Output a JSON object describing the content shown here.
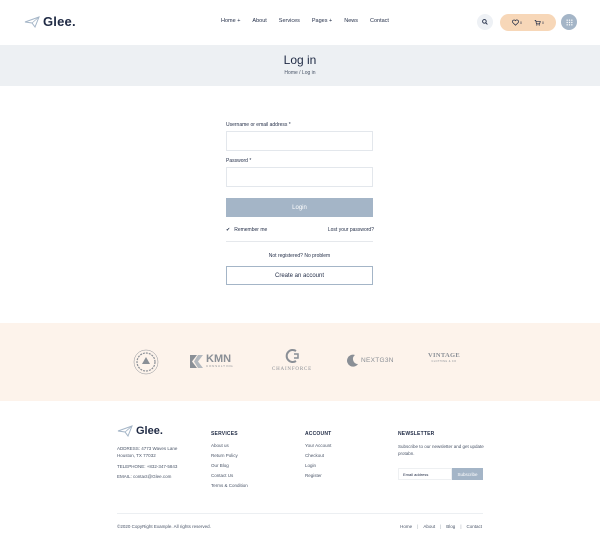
{
  "header": {
    "brand": "Glee.",
    "nav": [
      "Home +",
      "About",
      "Services",
      "Pages +",
      "News",
      "Contact"
    ],
    "pill_count_1": "0",
    "pill_count_2": "0"
  },
  "banner": {
    "title": "Log in",
    "breadcrumb": "Home  /  Log in"
  },
  "form": {
    "username_label": "Username or email address *",
    "password_label": "Password *",
    "login_label": "Login",
    "remember_label": "Remember me",
    "lost_password": "Lost your password?",
    "not_registered": "Not registered? No problem",
    "create_account": "Create an account"
  },
  "partners": [
    {
      "name": "SEA & SUN",
      "sub": "EXCHANGE"
    },
    {
      "name": "KMN",
      "sub": "CONSULTING"
    },
    {
      "name": "CHAINFORCE",
      "sub": ""
    },
    {
      "name": "NEXTG3N",
      "sub": ""
    },
    {
      "name": "VINTAGE",
      "sub": "CLOTHING & CO"
    }
  ],
  "footer": {
    "brand": "Glee.",
    "address_line1": "ADDRESS: 4773 Waves Lane",
    "address_line2": "Houston, TX 77032",
    "telephone": "TELEPHONE: +832-347-5843",
    "email": "EMAIL: contact@Glee.com",
    "services_title": "SERVICES",
    "services": [
      "About us",
      "Return Policy",
      "Our Blog",
      "Contact Us",
      "Terms & Condition"
    ],
    "account_title": "ACCOUNT",
    "account": [
      "Your Account",
      "Checkout",
      "Login",
      "Register"
    ],
    "newsletter_title": "NEWSLETTER",
    "newsletter_text": "Subscribe to our newsletter and get update protabn.",
    "email_placeholder": "Email address",
    "subscribe_label": "Subscribe",
    "copyright": "©2020 CopyRight Example. All rights reserved.",
    "links": [
      "Home",
      "About",
      "Blog",
      "Contact"
    ]
  },
  "colors": {
    "accent": "#a4b5c7",
    "pill": "#f7d7b8",
    "banner_bg": "#edf0f3",
    "partners_bg": "#fdf3eb",
    "text": "#1f2a44"
  }
}
